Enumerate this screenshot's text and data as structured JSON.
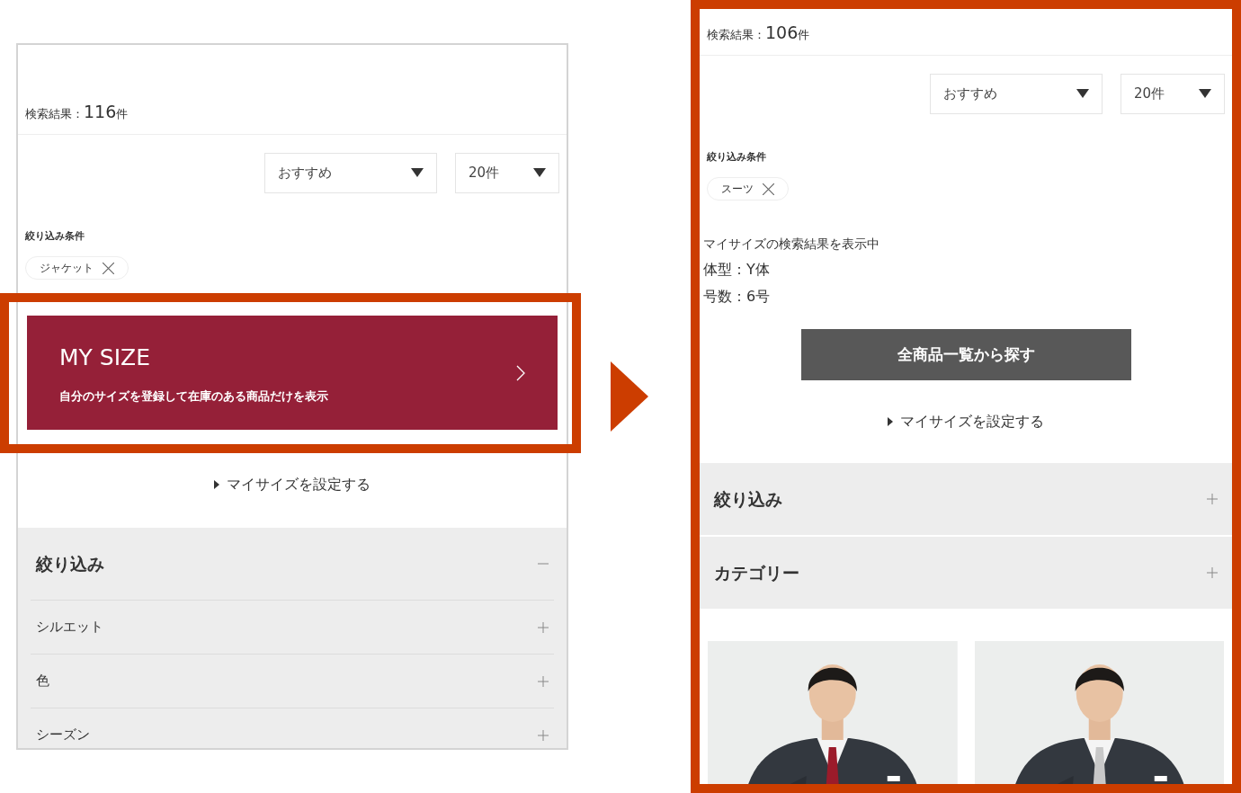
{
  "screens": [
    {
      "highlighted": false,
      "blocks": [
        {
          "kind": "result",
          "label": "検索結果：",
          "count": "116",
          "unit": "件"
        },
        {
          "kind": "sort",
          "selects": [
            "おすすめ",
            "20件"
          ]
        },
        {
          "kind": "conditions",
          "title": "絞り込み条件",
          "chips": [
            "ジャケット"
          ]
        },
        {
          "kind": "banner",
          "title": "MY SIZE",
          "text": "自分のサイズを登録して在庫のある商品だけを表示",
          "highlighted": true
        },
        {
          "kind": "link",
          "text": "マイサイズを設定する"
        },
        {
          "kind": "accordion",
          "sections": [
            {
              "title": "絞り込み",
              "expanded": true,
              "children": [
                {
                  "title": "シルエット",
                  "expanded": false
                },
                {
                  "title": "色",
                  "expanded": false
                },
                {
                  "title": "シーズン",
                  "expanded": false
                }
              ]
            }
          ]
        }
      ]
    },
    {
      "highlighted": true,
      "blocks": [
        {
          "kind": "result",
          "label": "検索結果：",
          "count": "106",
          "unit": "件"
        },
        {
          "kind": "sort",
          "selects": [
            "おすすめ",
            "20件"
          ]
        },
        {
          "kind": "conditions",
          "title": "絞り込み条件",
          "chips": [
            "スーツ"
          ]
        },
        {
          "kind": "info",
          "lines": [
            "マイサイズの検索結果を表示中",
            "体型：Y体",
            "号数：6号"
          ]
        },
        {
          "kind": "button",
          "text": "全商品一覧から探す"
        },
        {
          "kind": "link",
          "text": "マイサイズを設定する"
        },
        {
          "kind": "accordion",
          "sections": [
            {
              "title": "絞り込み",
              "expanded": false
            },
            {
              "title": "カテゴリー",
              "expanded": false
            }
          ]
        },
        {
          "kind": "products"
        }
      ]
    }
  ]
}
